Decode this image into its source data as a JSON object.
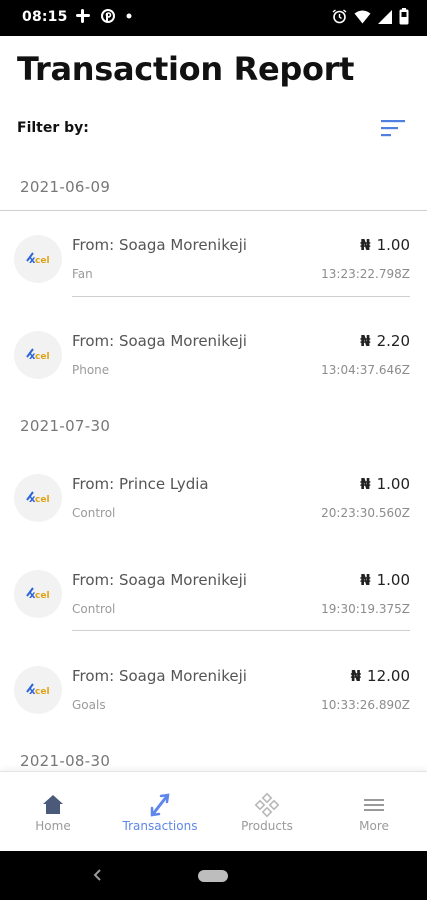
{
  "status_bar": {
    "time": "08:15",
    "left_icons": [
      "slack-icon",
      "pinterest-icon",
      "dot-icon"
    ],
    "right_icons": [
      "alarm-icon",
      "wifi-icon",
      "signal-icon",
      "battery-icon"
    ]
  },
  "header": {
    "title": "Transaction Report",
    "filter_label": "Filter by:",
    "filter_icon": "sort-icon",
    "accent_color": "#4f7fe0"
  },
  "groups": [
    {
      "date": "2021-06-09",
      "transactions": [
        {
          "from": "From: Soaga Morenikeji",
          "product": "Fan",
          "currency": "₦",
          "amount": "1.00",
          "time": "13:23:22.798Z",
          "logo": "xcel"
        },
        {
          "from": "From: Soaga Morenikeji",
          "product": "Phone",
          "currency": "₦",
          "amount": "2.20",
          "time": "13:04:37.646Z",
          "logo": "xcel"
        }
      ]
    },
    {
      "date": "2021-07-30",
      "transactions": [
        {
          "from": "From: Prince Lydia",
          "product": "Control",
          "currency": "₦",
          "amount": "1.00",
          "time": "20:23:30.560Z",
          "logo": "xcel"
        },
        {
          "from": "From: Soaga Morenikeji",
          "product": "Control",
          "currency": "₦",
          "amount": "1.00",
          "time": "19:30:19.375Z",
          "logo": "xcel"
        },
        {
          "from": "From: Soaga Morenikeji",
          "product": "Goals",
          "currency": "₦",
          "amount": "12.00",
          "time": "10:33:26.890Z",
          "logo": "xcel"
        }
      ]
    },
    {
      "date": "2021-08-30",
      "transactions": []
    }
  ],
  "bottom_nav": [
    {
      "label": "Home",
      "icon": "home-icon",
      "active": false
    },
    {
      "label": "Transactions",
      "icon": "transactions-icon",
      "active": true
    },
    {
      "label": "Products",
      "icon": "products-icon",
      "active": false
    },
    {
      "label": "More",
      "icon": "menu-icon",
      "active": false
    }
  ]
}
